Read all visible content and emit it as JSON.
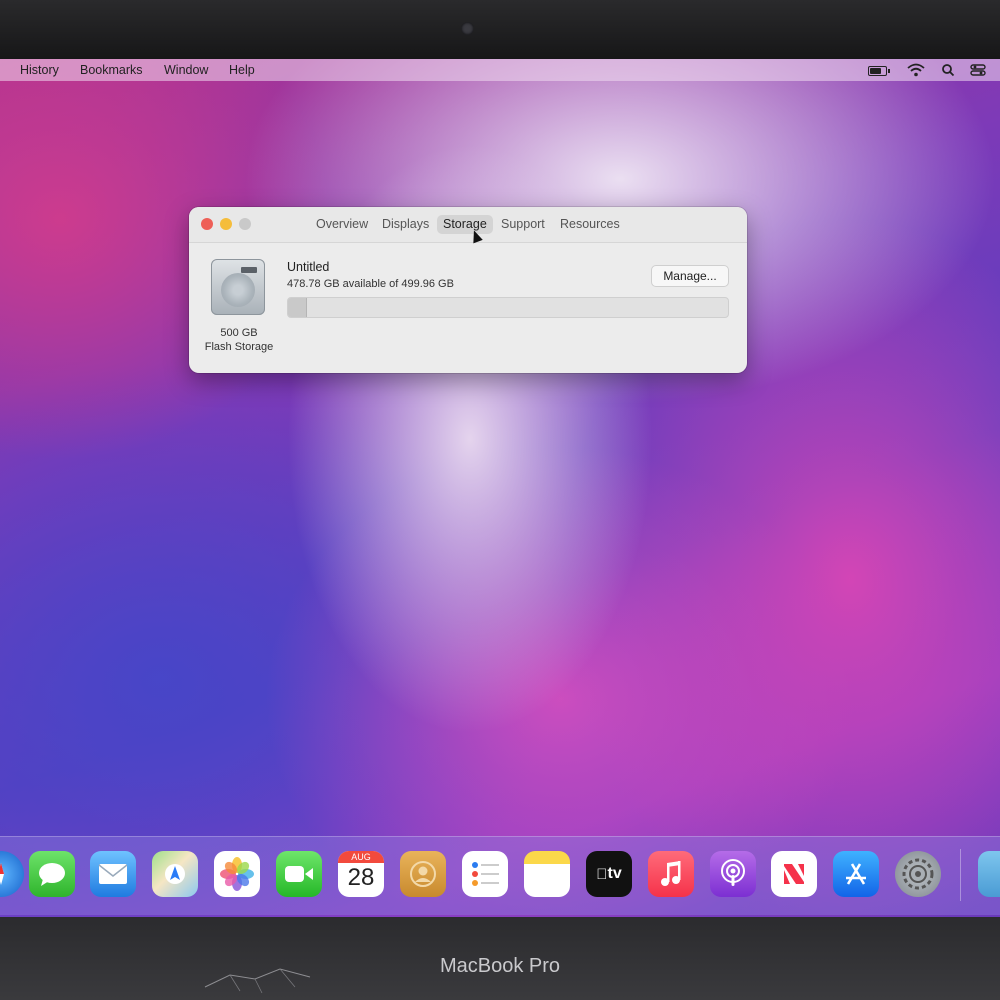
{
  "menubar": {
    "items": [
      "History",
      "Bookmarks",
      "Window",
      "Help"
    ],
    "status_icons": [
      "battery-icon",
      "wifi-icon",
      "search-icon",
      "control-center-icon"
    ]
  },
  "window": {
    "tabs": [
      "Overview",
      "Displays",
      "Storage",
      "Support",
      "Resources"
    ],
    "active_tab": "Storage",
    "drive": {
      "size_label": "500 GB",
      "type_label": "Flash Storage",
      "icon": "hard-drive-icon"
    },
    "volume": {
      "name": "Untitled",
      "availability": "478.78 GB available of 499.96 GB",
      "used_fraction": 0.042
    },
    "manage_label": "Manage..."
  },
  "dock": {
    "calendar": {
      "month": "AUG",
      "day": "28"
    },
    "apps": [
      "Safari",
      "Messages",
      "Mail",
      "Maps",
      "Photos",
      "FaceTime",
      "Calendar",
      "Contacts",
      "Reminders",
      "Notes",
      "TV",
      "Music",
      "Podcasts",
      "News",
      "App Store",
      "System Preferences",
      "Folder"
    ],
    "tv_label": "tv"
  },
  "device": {
    "brand": "MacBook Pro"
  }
}
